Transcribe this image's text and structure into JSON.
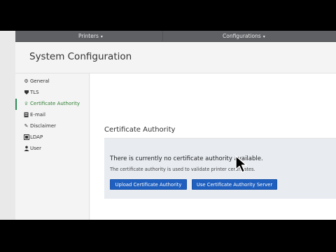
{
  "topnav": {
    "items": [
      {
        "label": "Printers",
        "caret": "▾"
      },
      {
        "label": "Configurations",
        "caret": "▾"
      }
    ]
  },
  "header": {
    "title": "System Configuration"
  },
  "sidebar": {
    "items": [
      {
        "label": "General",
        "icon": "gear-icon",
        "glyph": "⚙",
        "active": false
      },
      {
        "label": "TLS",
        "icon": "tls-icon",
        "glyph": "🛡",
        "active": false
      },
      {
        "label": "Certificate Authority",
        "icon": "certificate-icon",
        "glyph": "♕",
        "active": true
      },
      {
        "label": "E-mail",
        "icon": "email-icon",
        "glyph": "✉",
        "active": false
      },
      {
        "label": "Disclaimer",
        "icon": "disclaimer-icon",
        "glyph": "✎",
        "active": false
      },
      {
        "label": "LDAP",
        "icon": "ldap-icon",
        "glyph": "▦",
        "active": false
      },
      {
        "label": "User",
        "icon": "user-icon",
        "glyph": "●",
        "active": false
      }
    ]
  },
  "main": {
    "section_title": "Certificate Authority",
    "message": "There is currently no certificate authority available.",
    "help": "The certificate authority is used to validate printer certificates.",
    "upload_label": "Upload Certificate Authority",
    "server_label": "Use Certificate Authority Server"
  },
  "colors": {
    "topnav_bg": "#5e6064",
    "active_accent": "#2e7d32",
    "button_bg": "#1f5fbf",
    "panel_bg": "#e8ecf1"
  }
}
